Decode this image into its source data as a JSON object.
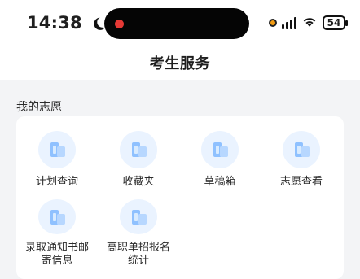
{
  "status_bar": {
    "time": "14:38",
    "battery": "54"
  },
  "nav": {
    "title": "考生服务"
  },
  "section": {
    "title": "我的志愿"
  },
  "tiles": [
    {
      "label": "计划查询"
    },
    {
      "label": "收藏夹"
    },
    {
      "label": "草稿箱"
    },
    {
      "label": "志愿查看"
    },
    {
      "label": "录取通知书邮\n寄信息"
    },
    {
      "label": "高职单招报名\n统计"
    }
  ],
  "colors": {
    "page_bg": "#f3f4f6",
    "card_bg": "#ffffff",
    "icon_bg": "#eaf3ff",
    "icon_blue": "#8fc1ff",
    "island": "#050505",
    "island_red": "#e53935"
  }
}
